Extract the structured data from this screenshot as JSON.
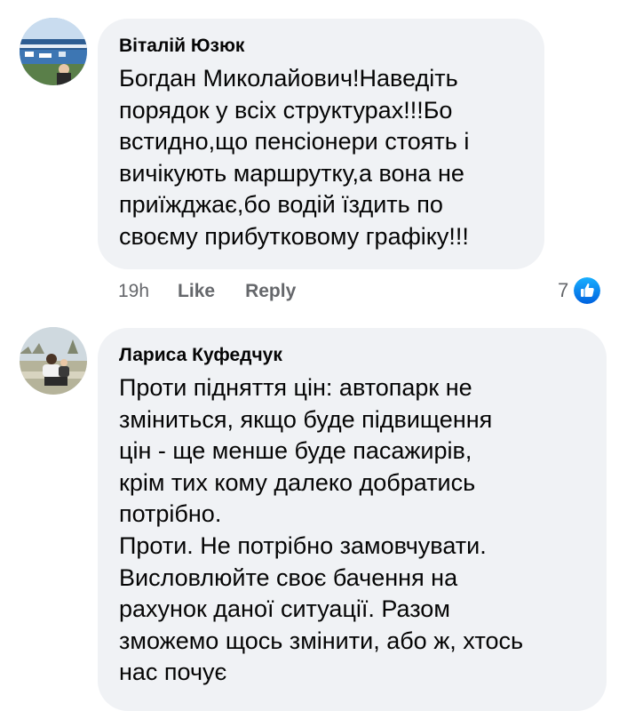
{
  "comments": [
    {
      "author": "Віталій Юзюк",
      "text": "Богдан Миколайович!Наведіть\nпорядок у всіх структурах!!!Бо\nвстидно,що пенсіонери стоять і\nвичікують маршрутку,а вона не\nприїжджає,бо водій їздить по\nсвоєму прибутковому графіку!!!",
      "time": "19h",
      "like_label": "Like",
      "reply_label": "Reply",
      "reaction_count": "7",
      "reaction_icon": "like-reaction-icon",
      "avatar_icon": "stadium-photo-avatar"
    },
    {
      "author": "Лариса Куфедчук",
      "text": "Проти підняття цін: автопарк не\nзміниться, якщо буде підвищення\nцін - ще менше буде пасажирів,\nкрім тих кому далеко добратись\nпотрібно.\nПроти. Не потрібно замовчувати.\nВисловлюйте своє бачення на\nрахунок даної ситуації. Разом\nзможемо щось змінити, або ж, хтось\nнас почує",
      "avatar_icon": "outdoor-photo-avatar"
    }
  ],
  "colors": {
    "bubble": "#f0f2f5",
    "text": "#050505",
    "secondary_text": "#65676b",
    "like_blue": "#1877f2"
  }
}
